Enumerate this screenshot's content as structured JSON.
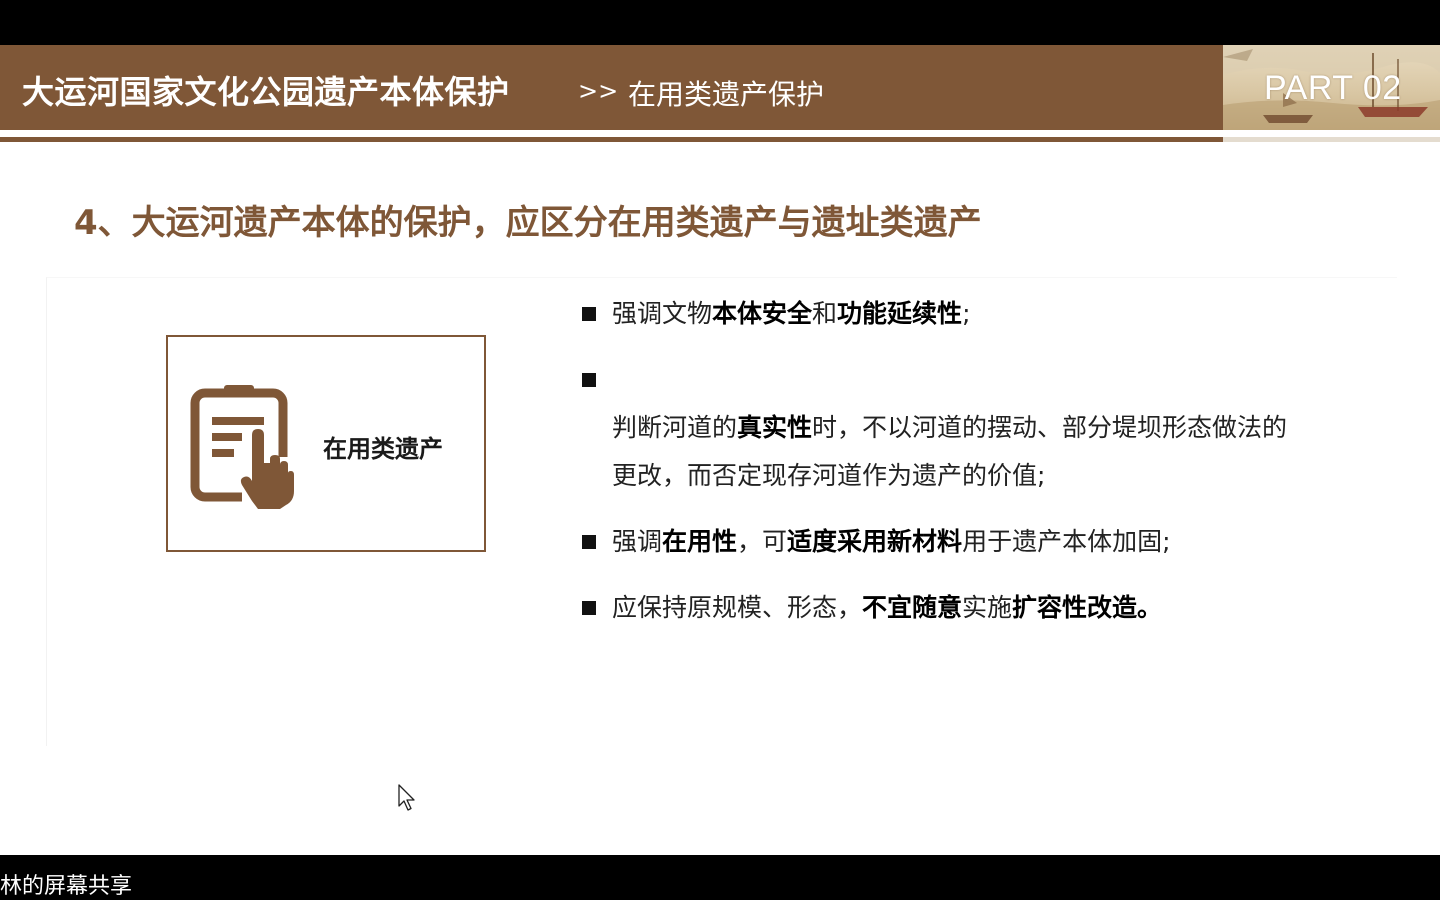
{
  "header": {
    "title": "大运河国家文化公园遗产本体保护",
    "separator": ">>",
    "subtitle": "在用类遗产保护",
    "part_label": "PART 02",
    "brand_color": "#7f5737"
  },
  "section": {
    "heading": "4、大运河遗产本体的保护，应区分在用类遗产与遗址类遗产"
  },
  "card": {
    "label": "在用类遗产",
    "icon": "document-hand-icon"
  },
  "bullets": [
    {
      "segments": [
        {
          "text": "强调文物",
          "bold": false
        },
        {
          "text": "本体安全",
          "bold": true
        },
        {
          "text": "和",
          "bold": false
        },
        {
          "text": "功能延续性",
          "bold": true
        },
        {
          "text": ";",
          "bold": false
        }
      ]
    },
    {
      "segments": [
        {
          "text": "判断河道的",
          "bold": false
        },
        {
          "text": "真实性",
          "bold": true
        },
        {
          "text": "时，不以河道的摆动、部分堤坝形态做法的",
          "bold": false
        },
        {
          "text": "\n更改，而否定现存河道作为遗产的价值;",
          "bold": false
        }
      ]
    },
    {
      "segments": [
        {
          "text": "强调",
          "bold": false
        },
        {
          "text": "在用性",
          "bold": true
        },
        {
          "text": "，可",
          "bold": false
        },
        {
          "text": "适度采用新材料",
          "bold": true
        },
        {
          "text": "用于遗产本体加固;",
          "bold": false
        }
      ]
    },
    {
      "segments": [
        {
          "text": "应保持原规模、形态，",
          "bold": false
        },
        {
          "text": "不宜随意",
          "bold": true
        },
        {
          "text": "实施",
          "bold": false
        },
        {
          "text": "扩容性改造。",
          "bold": true
        }
      ]
    }
  ],
  "screen_share": {
    "label": "林的屏幕共享"
  }
}
